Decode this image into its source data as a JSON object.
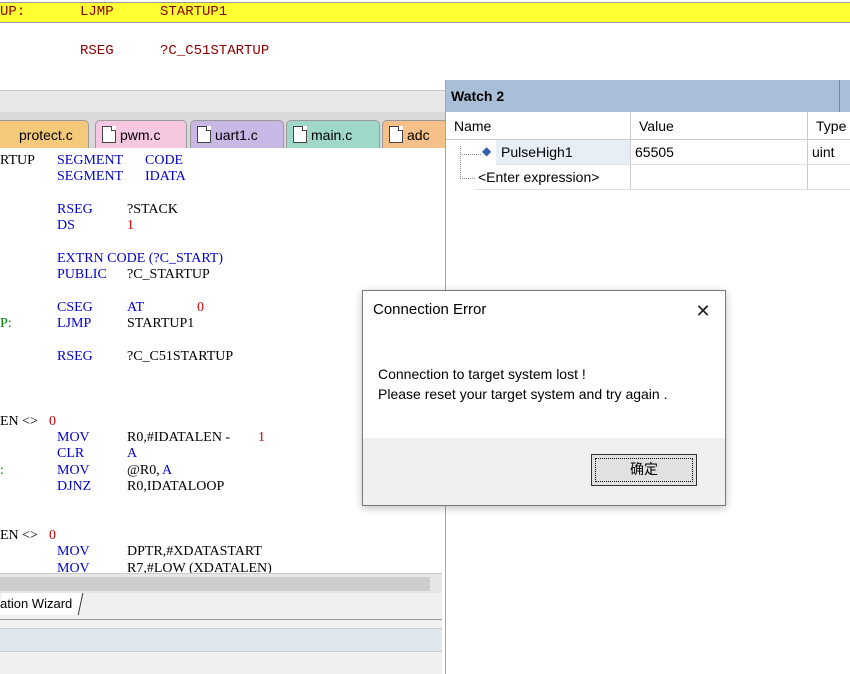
{
  "disassembly": {
    "line1": {
      "label": "UP:",
      "mnemonic": "LJMP",
      "operand": "STARTUP1"
    },
    "line2": {
      "mnemonic": "RSEG",
      "operand": "?C_C51STARTUP"
    }
  },
  "tabs": [
    {
      "label": "protect.c",
      "color": "#f5c97a"
    },
    {
      "label": "pwm.c",
      "color": "#f5c7e0"
    },
    {
      "label": "uart1.c",
      "color": "#c9b8e6"
    },
    {
      "label": "main.c",
      "color": "#9fd7c8"
    },
    {
      "label": "adc",
      "color": "#f5c08a"
    }
  ],
  "code": [
    {
      "seg": [
        [
          "RTUP",
          "black",
          0
        ],
        [
          "SEGMENT",
          "blue",
          57
        ],
        [
          "CODE",
          "blue",
          145
        ]
      ]
    },
    {
      "seg": [
        [
          "SEGMENT",
          "blue",
          57
        ],
        [
          "IDATA",
          "blue",
          145
        ]
      ]
    },
    {
      "seg": []
    },
    {
      "seg": [
        [
          "RSEG",
          "blue",
          57
        ],
        [
          "?STACK",
          "black",
          127
        ]
      ]
    },
    {
      "seg": [
        [
          "DS",
          "blue",
          57
        ],
        [
          "1",
          "red",
          127
        ]
      ]
    },
    {
      "seg": []
    },
    {
      "seg": [
        [
          "EXTRN CODE (?C_START)",
          "blue",
          57
        ]
      ]
    },
    {
      "seg": [
        [
          "PUBLIC",
          "blue",
          57
        ],
        [
          "?C_STARTUP",
          "black",
          127
        ]
      ]
    },
    {
      "seg": []
    },
    {
      "seg": [
        [
          "CSEG",
          "blue",
          57
        ],
        [
          "AT",
          "blue",
          127
        ],
        [
          "0",
          "red",
          197
        ]
      ]
    },
    {
      "seg": [
        [
          "P:",
          "green",
          0
        ],
        [
          "LJMP",
          "blue",
          57
        ],
        [
          "STARTUP1",
          "black",
          127
        ]
      ]
    },
    {
      "seg": []
    },
    {
      "seg": [
        [
          "RSEG",
          "blue",
          57
        ],
        [
          "?C_C51STARTUP",
          "black",
          127
        ]
      ]
    },
    {
      "seg": []
    },
    {
      "seg": []
    },
    {
      "seg": []
    },
    {
      "seg": [
        [
          "EN <>",
          "black",
          0
        ],
        [
          "0",
          "red",
          49
        ]
      ]
    },
    {
      "seg": [
        [
          "MOV",
          "blue",
          57
        ],
        [
          "R0,#IDATALEN -",
          "black",
          127
        ],
        [
          "1",
          "red",
          258
        ]
      ]
    },
    {
      "seg": [
        [
          "CLR",
          "blue",
          57
        ],
        [
          "A",
          "blue",
          127
        ]
      ]
    },
    {
      "seg": [
        [
          ":",
          "green",
          0
        ],
        [
          "MOV",
          "blue",
          57
        ],
        [
          "@R0,",
          "black",
          127
        ],
        [
          "A",
          "blue",
          162
        ]
      ]
    },
    {
      "seg": [
        [
          "DJNZ",
          "blue",
          57
        ],
        [
          "R0,IDATALOOP",
          "black",
          127
        ]
      ]
    },
    {
      "seg": []
    },
    {
      "seg": []
    },
    {
      "seg": [
        [
          "EN <>",
          "black",
          0
        ],
        [
          "0",
          "red",
          49
        ]
      ]
    },
    {
      "seg": [
        [
          "MOV",
          "blue",
          57
        ],
        [
          "DPTR,#XDATASTART",
          "black",
          127
        ]
      ]
    },
    {
      "seg": [
        [
          "MOV",
          "blue",
          57
        ],
        [
          "R7,#LOW (XDATALEN)",
          "black",
          127
        ]
      ]
    }
  ],
  "wizard_tab": "ation Wizard",
  "watch": {
    "title": "Watch 2",
    "columns": [
      "Name",
      "Value",
      "Type"
    ],
    "rows": [
      {
        "name": "PulseHigh1",
        "value": "65505",
        "type": "uint"
      },
      {
        "name": "<Enter expression>",
        "value": "",
        "type": ""
      }
    ]
  },
  "dialog": {
    "title": "Connection Error",
    "message_line1": "Connection to target system lost !",
    "message_line2": "Please reset your target system and try again .",
    "ok_label": "确定",
    "close_glyph": "✕"
  },
  "colors": {
    "highlight_line": "#ffff33",
    "keyword_blue": "#0000cc",
    "number_red": "#cc0000",
    "label_green": "#008000",
    "watch_title_bg": "#a9bfd8"
  }
}
